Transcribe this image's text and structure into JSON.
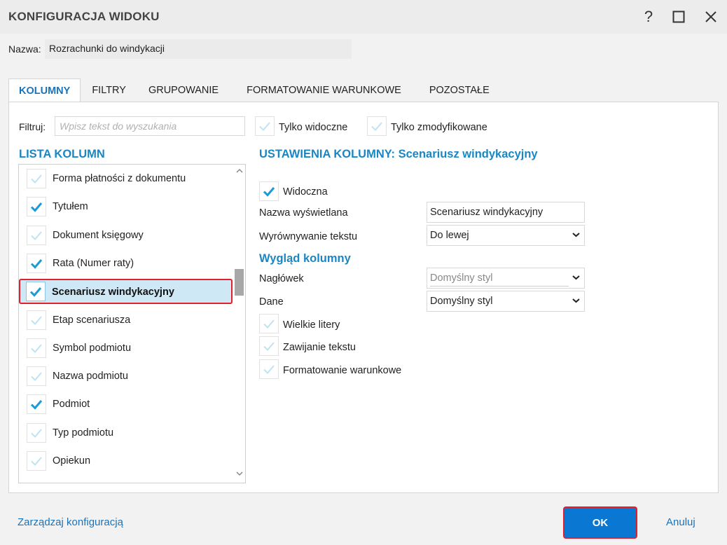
{
  "window": {
    "title": "KONFIGURACJA WIDOKU",
    "help": "?",
    "maximize": "☐",
    "close": "✕"
  },
  "name_field": {
    "label": "Nazwa:",
    "value": "Rozrachunki do windykacji"
  },
  "tabs": [
    {
      "label": "KOLUMNY",
      "active": true
    },
    {
      "label": "FILTRY",
      "active": false
    },
    {
      "label": "GRUPOWANIE",
      "active": false
    },
    {
      "label": "FORMATOWANIE WARUNKOWE",
      "active": false
    },
    {
      "label": "POZOSTAŁE",
      "active": false
    }
  ],
  "filter": {
    "label": "Filtruj:",
    "placeholder": "Wpisz tekst do wyszukania",
    "only_visible_label": "Tylko widoczne",
    "only_modified_label": "Tylko zmodyfikowane"
  },
  "column_list": {
    "heading": "LISTA KOLUMN",
    "items": [
      {
        "label": "Forma płatności z dokumentu",
        "checked": false
      },
      {
        "label": "Tytułem",
        "checked": true
      },
      {
        "label": "Dokument księgowy",
        "checked": false
      },
      {
        "label": "Rata (Numer raty)",
        "checked": true
      },
      {
        "label": "Scenariusz windykacyjny",
        "checked": true,
        "selected": true
      },
      {
        "label": "Etap scenariusza",
        "checked": false
      },
      {
        "label": "Symbol podmiotu",
        "checked": false
      },
      {
        "label": "Nazwa podmiotu",
        "checked": false
      },
      {
        "label": "Podmiot",
        "checked": true
      },
      {
        "label": "Typ podmiotu",
        "checked": false
      },
      {
        "label": "Opiekun",
        "checked": false
      }
    ]
  },
  "column_settings": {
    "heading": "USTAWIENIA KOLUMNY: Scenariusz windykacyjny",
    "visible_label": "Widoczna",
    "visible_checked": true,
    "display_name_label": "Nazwa wyświetlana",
    "display_name_value": "Scenariusz windykacyjny",
    "align_label": "Wyrównywanie tekstu",
    "align_value": "Do lewej",
    "appearance_heading": "Wygląd kolumny",
    "header_label": "Nagłówek",
    "header_value": "Domyślny styl",
    "data_label": "Dane",
    "data_value": "Domyślny styl",
    "uppercase_label": "Wielkie litery",
    "wrap_label": "Zawijanie tekstu",
    "cond_format_label": "Formatowanie warunkowe"
  },
  "footer": {
    "manage_label": "Zarządzaj konfiguracją",
    "ok_label": "OK",
    "cancel_label": "Anuluj"
  },
  "colors": {
    "accent": "#1a86c3",
    "ok_button": "#0a78d2",
    "highlight_border": "#e0202c",
    "selected_row": "#cfe8f6",
    "check_active": "#1a9ad6",
    "check_inactive": "#bfe3f3"
  }
}
